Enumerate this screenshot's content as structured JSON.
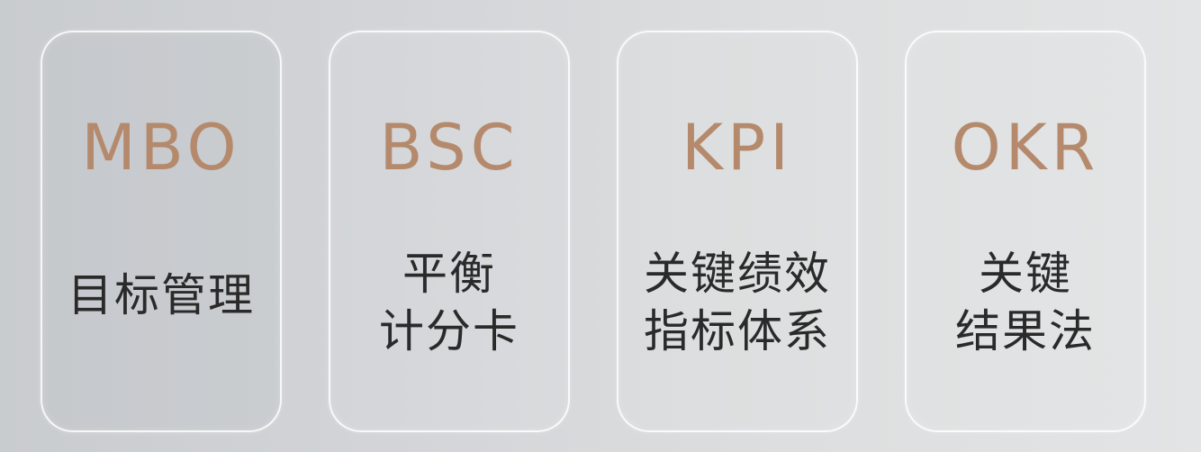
{
  "cards": [
    {
      "abbr": "MBO",
      "lines": [
        "目标管理"
      ]
    },
    {
      "abbr": "BSC",
      "lines": [
        "平衡",
        "计分卡"
      ]
    },
    {
      "abbr": "KPI",
      "lines": [
        "关键绩效",
        "指标体系"
      ]
    },
    {
      "abbr": "OKR",
      "lines": [
        "关键",
        "结果法"
      ]
    }
  ],
  "colors": {
    "abbr": "#b58a6c",
    "text": "#2a2a2a",
    "card_border": "#ffffff"
  }
}
